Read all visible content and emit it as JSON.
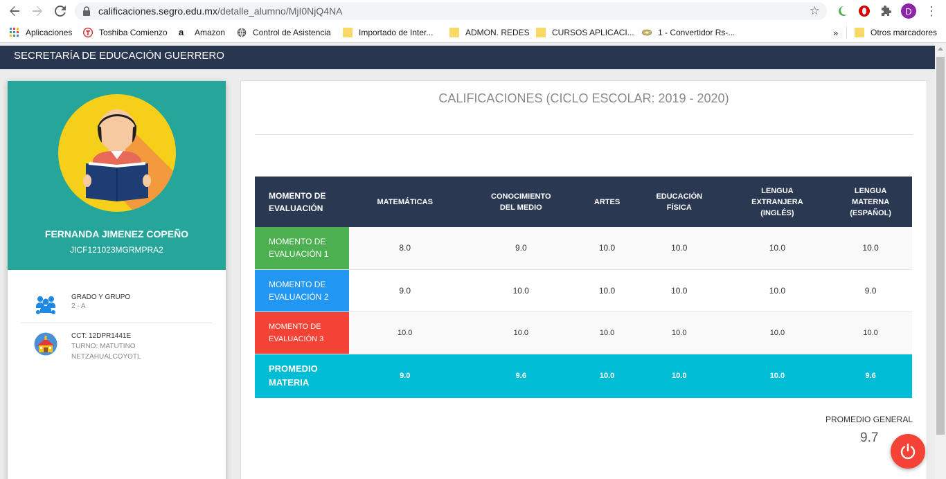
{
  "browser": {
    "url_host": "calificaciones.segro.edu.mx",
    "url_path": "/detalle_alumno/MjI0NjQ4NA",
    "profile_initial": "D",
    "bookmarks": [
      {
        "label": "Aplicaciones",
        "icon": "apps-grid-icon"
      },
      {
        "label": "Toshiba Comienzo",
        "icon": "toshiba-icon"
      },
      {
        "label": "Amazon",
        "icon": "amazon-icon"
      },
      {
        "label": "Control de Asistencia",
        "icon": "globe-icon"
      },
      {
        "label": "Importado de Inter...",
        "icon": "folder-icon"
      },
      {
        "label": "ADMON. REDES",
        "icon": "folder-icon"
      },
      {
        "label": "CURSOS APLICACI...",
        "icon": "folder-icon"
      },
      {
        "label": "1 - Convertidor Rs-...",
        "icon": "site-icon"
      }
    ],
    "more_bookmarks": "»",
    "other_bookmarks": "Otros marcadores"
  },
  "header": {
    "title": "SECRETARÍA DE EDUCACIÓN GUERRERO",
    "bg_color": "#29364f"
  },
  "student": {
    "name": "FERNANDA JIMENEZ COPEÑO",
    "curp": "JICF121023MGRMPRA2",
    "card_color": "#26a69a",
    "group_label": "GRADO Y GRUPO",
    "group_value": "2 - A",
    "cct_label": "CCT: 12DPR1441E",
    "shift": "TURNO: MATUTINO",
    "location": "NETZAHUALCOYOTL"
  },
  "grades": {
    "title": "CALIFICACIONES (CICLO ESCOLAR: 2019 - 2020)",
    "headers": [
      "MOMENTO DE\nEVALUACIÓN",
      "MATEMÁTICAS",
      "CONOCIMIENTO\nDEL MEDIO",
      "ARTES",
      "EDUCACIÓN\nFÍSICA",
      "LENGUA\nEXTRANJERA\n(INGLÉS)",
      "LENGUA\nMATERNA\n(ESPAÑOL)"
    ],
    "rows": [
      {
        "moment": "MOMENTO DE\nEVALUACIÓN 1",
        "color": "#4caf50",
        "values": [
          "8.0",
          "9.0",
          "10.0",
          "10.0",
          "10.0",
          "10.0"
        ]
      },
      {
        "moment": "MOMENTO DE\nEVALUACIÓN 2",
        "color": "#2196f3",
        "values": [
          "9.0",
          "10.0",
          "10.0",
          "10.0",
          "10.0",
          "9.0"
        ]
      },
      {
        "moment": "MOMENTO DE\nEVALUACIÓN 3",
        "color": "#f44336",
        "values": [
          "10.0",
          "10.0",
          "10.0",
          "10.0",
          "10.0",
          "10.0"
        ]
      }
    ],
    "average": {
      "label": "PROMEDIO\nMATERIA",
      "color": "#00bcd4",
      "values": [
        "9.0",
        "9.6",
        "10.0",
        "10.0",
        "10.0",
        "9.6"
      ]
    },
    "general_label": "PROMEDIO GENERAL",
    "general_value": "9.7"
  },
  "actions": {
    "logout_icon": "power-icon",
    "logout_color": "#f44336"
  }
}
